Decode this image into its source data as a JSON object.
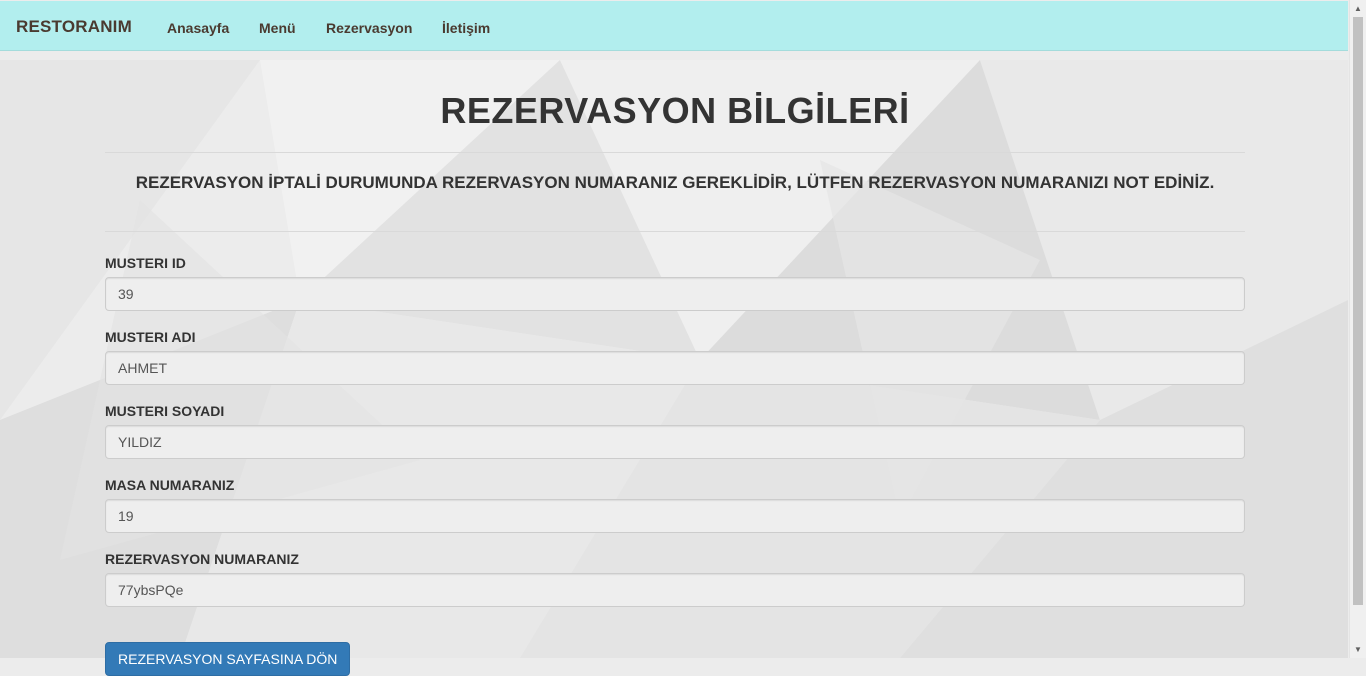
{
  "navbar": {
    "brand": "RESTORANIM",
    "links": [
      "Anasayfa",
      "Menü",
      "Rezervasyon",
      "İletişim"
    ]
  },
  "page": {
    "title": "REZERVASYON BİLGİLERİ",
    "notice": "REZERVASYON İPTALİ DURUMUNDA REZERVASYON NUMARANIZ GEREKLİDİR, LÜTFEN REZERVASYON NUMARANIZI NOT EDİNİZ."
  },
  "form": {
    "fields": [
      {
        "label": "MUSTERI ID",
        "value": "39"
      },
      {
        "label": "MUSTERI ADI",
        "value": "AHMET"
      },
      {
        "label": "MUSTERI SOYADI",
        "value": "YILDIZ"
      },
      {
        "label": "MASA NUMARANIZ",
        "value": "19"
      },
      {
        "label": "REZERVASYON NUMARANIZ",
        "value": "77ybsPQe"
      }
    ],
    "back_button": "REZERVASYON SAYFASINA DÖN"
  },
  "colors": {
    "navbar_bg": "#b2eeee",
    "primary_button": "#337ab7"
  }
}
